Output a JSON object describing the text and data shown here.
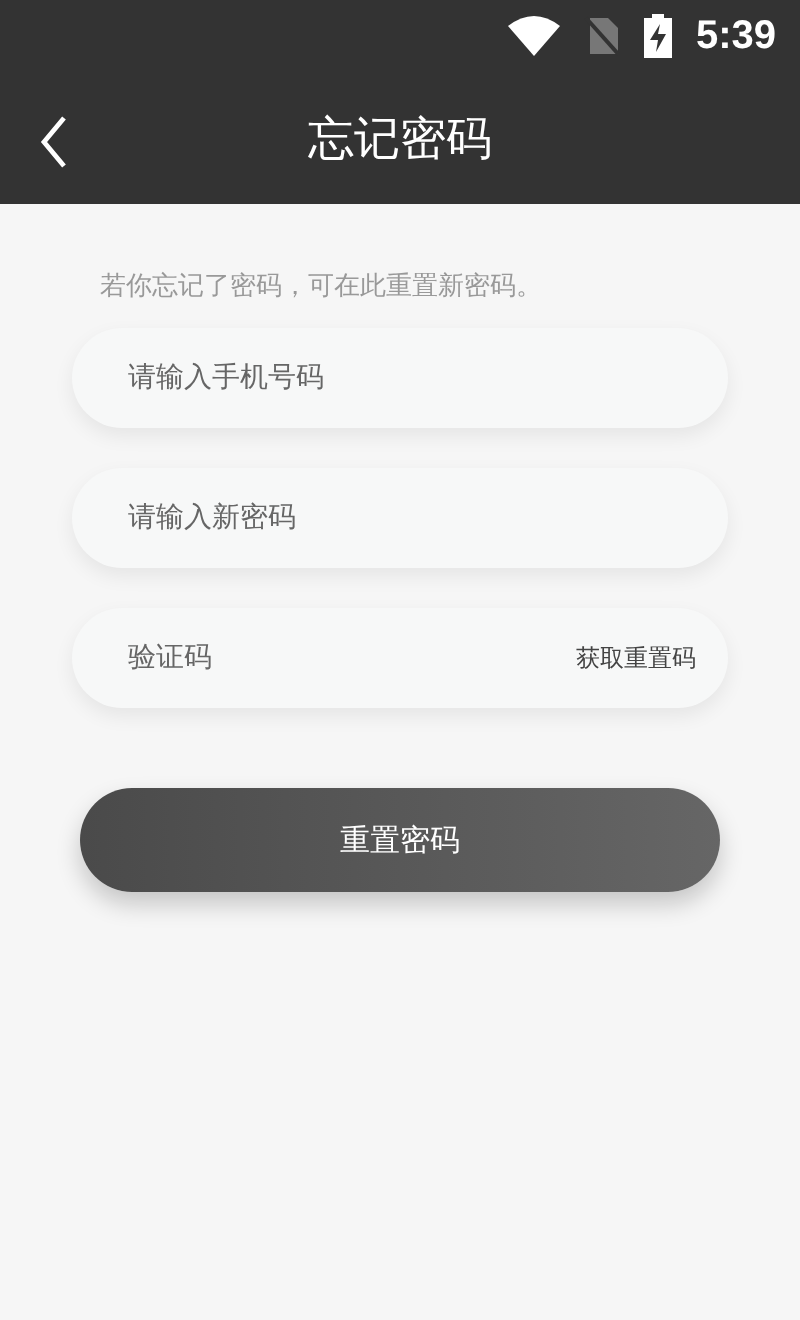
{
  "status_bar": {
    "time": "5:39"
  },
  "header": {
    "title": "忘记密码"
  },
  "hint": "若你忘记了密码，可在此重置新密码。",
  "fields": [
    {
      "kind": "plain",
      "placeholder": "请输入手机号码"
    },
    {
      "kind": "plain",
      "placeholder": "请输入新密码"
    },
    {
      "kind": "code",
      "placeholder": "验证码",
      "action": "获取重置码"
    }
  ],
  "submit": "重置密码"
}
